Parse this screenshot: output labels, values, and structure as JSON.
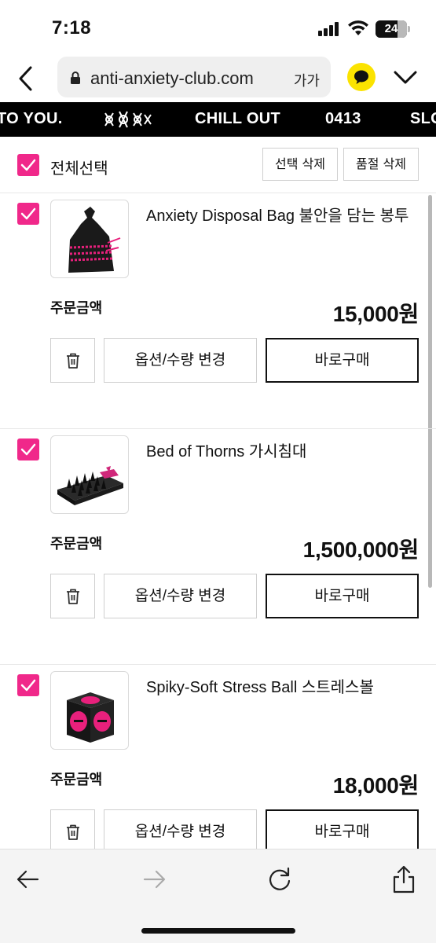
{
  "status": {
    "time": "7:18",
    "battery": "24"
  },
  "browser": {
    "url": "anti-anxiety-club.com",
    "text_size_label": "가가"
  },
  "marquee": {
    "items": [
      "TO YOU.",
      "CHILL OUT",
      "0413",
      "SLO"
    ]
  },
  "selection": {
    "select_all_label": "전체선택",
    "delete_selected_label": "선택 삭제",
    "delete_soldout_label": "품절 삭제"
  },
  "cart": {
    "items": [
      {
        "name": "Anxiety Disposal Bag 불안을 담는 봉투",
        "order_label": "주문금액",
        "price": "15,000원",
        "options_label": "옵션/수량 변경",
        "buy_label": "바로구매",
        "image": "black-bag-with-pink-text"
      },
      {
        "name": "Bed of Thorns 가시침대",
        "order_label": "주문금액",
        "price": "1,500,000원",
        "options_label": "옵션/수량 변경",
        "buy_label": "바로구매",
        "image": "black-spiked-bed-with-pink-pillows"
      },
      {
        "name": "Spiky-Soft Stress Ball 스트레스볼",
        "order_label": "주문금액",
        "price": "18,000원",
        "options_label": "옵션/수량 변경",
        "buy_label": "바로구매",
        "image": "black-cube-with-pink-circles"
      }
    ]
  },
  "colors": {
    "accent": "#f0288a",
    "kakao": "#fbe300"
  }
}
